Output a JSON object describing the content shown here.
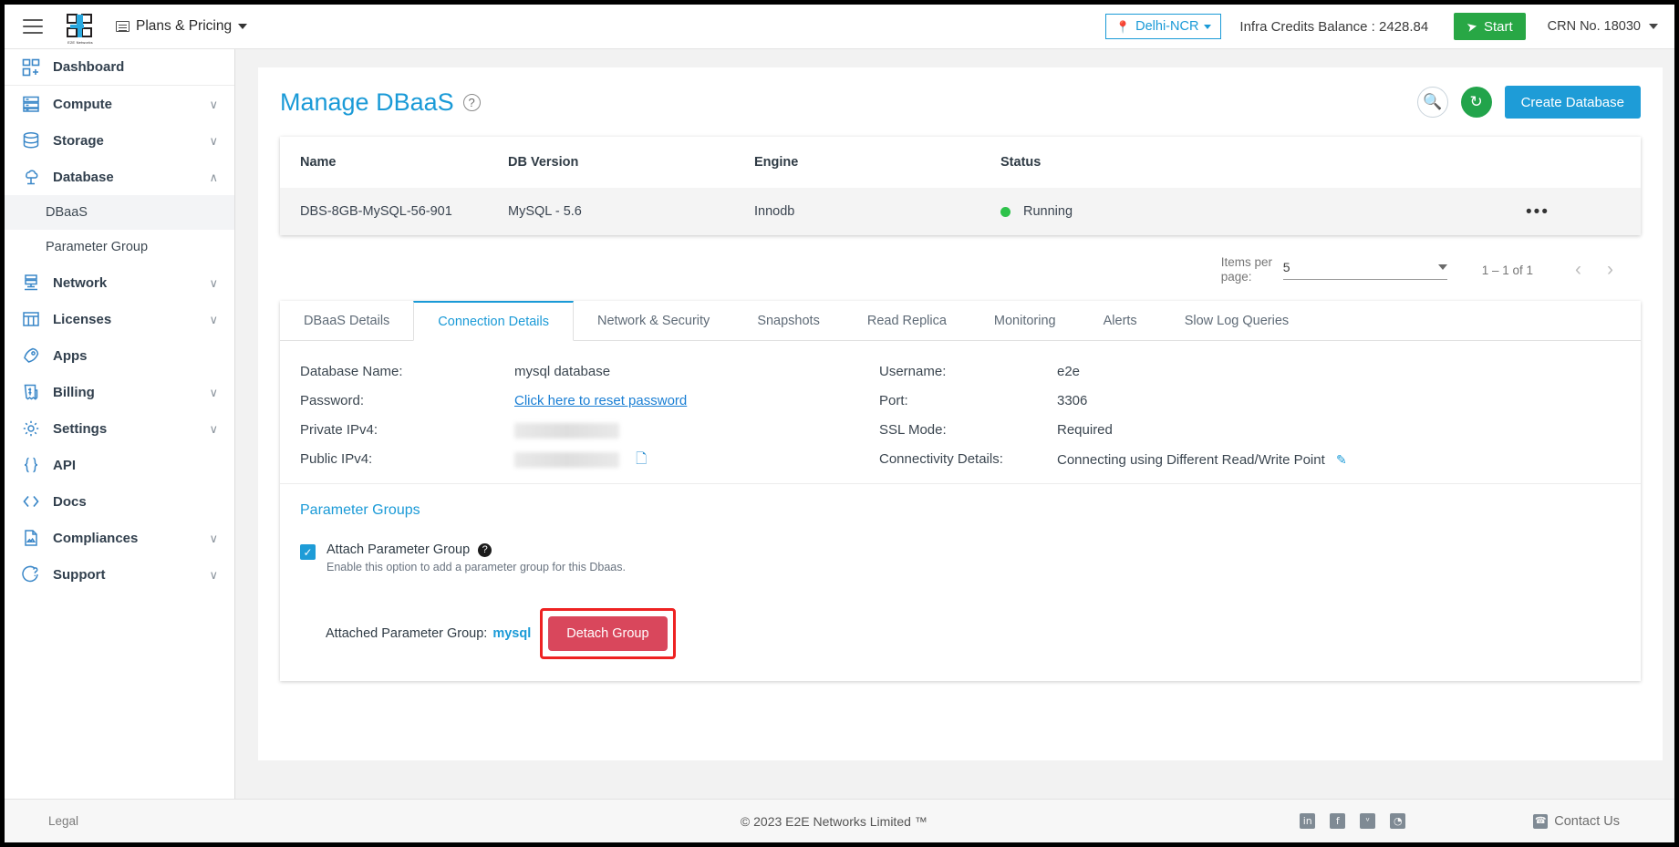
{
  "topbar": {
    "menu_icon": "hamburger-icon",
    "logo_text": "E2E Networks",
    "plans_label": "Plans & Pricing",
    "region": "Delhi-NCR",
    "credits": "Infra Credits Balance : 2428.84",
    "start_label": "Start",
    "crn": "CRN No. 18030"
  },
  "sidebar": {
    "items": [
      {
        "label": "Dashboard",
        "icon": "dashboard-icon",
        "chevron": ""
      },
      {
        "label": "Compute",
        "icon": "server-icon",
        "chevron": "∨"
      },
      {
        "label": "Storage",
        "icon": "storage-icon",
        "chevron": "∨"
      },
      {
        "label": "Database",
        "icon": "database-cloud-icon",
        "chevron": "∧"
      },
      {
        "label": "Network",
        "icon": "network-icon",
        "chevron": "∨"
      },
      {
        "label": "Licenses",
        "icon": "licenses-icon",
        "chevron": "∨"
      },
      {
        "label": "Apps",
        "icon": "rocket-icon",
        "chevron": ""
      },
      {
        "label": "Billing",
        "icon": "billing-icon",
        "chevron": "∨"
      },
      {
        "label": "Settings",
        "icon": "gear-icon",
        "chevron": "∨"
      },
      {
        "label": "API",
        "icon": "braces-icon",
        "chevron": ""
      },
      {
        "label": "Docs",
        "icon": "code-icon",
        "chevron": ""
      },
      {
        "label": "Compliances",
        "icon": "document-icon",
        "chevron": "∨"
      },
      {
        "label": "Support",
        "icon": "support-icon",
        "chevron": "∨"
      }
    ],
    "database_children": [
      {
        "label": "DBaaS",
        "active": true
      },
      {
        "label": "Parameter Group",
        "active": false
      }
    ]
  },
  "page": {
    "title": "Manage DBaaS",
    "help_icon": "help-circle-icon",
    "search_icon": "search-icon",
    "refresh_icon": "refresh-icon",
    "create_label": "Create Database"
  },
  "table": {
    "columns": [
      "Name",
      "DB Version",
      "Engine",
      "Status",
      ""
    ],
    "rows": [
      {
        "name": "DBS-8GB-MySQL-56-901",
        "db_version": "MySQL - 5.6",
        "engine": "Innodb",
        "status": "Running",
        "status_color": "#2ec24b",
        "actions_icon": "kebab-menu-icon"
      }
    ]
  },
  "paginator": {
    "items_per_page_label": "Items per page:",
    "items_per_page_value": "5",
    "range": "1 – 1 of 1",
    "prev_icon": "‹",
    "next_icon": "›"
  },
  "tabs": [
    {
      "label": "DBaaS Details",
      "active": false
    },
    {
      "label": "Connection Details",
      "active": true
    },
    {
      "label": "Network & Security",
      "active": false
    },
    {
      "label": "Snapshots",
      "active": false
    },
    {
      "label": "Read Replica",
      "active": false
    },
    {
      "label": "Monitoring",
      "active": false
    },
    {
      "label": "Alerts",
      "active": false
    },
    {
      "label": "Slow Log Queries",
      "active": false
    }
  ],
  "connection": {
    "left": [
      {
        "label": "Database Name:",
        "value": "mysql database",
        "kind": "text"
      },
      {
        "label": "Password:",
        "value": "Click here to reset password",
        "kind": "link"
      },
      {
        "label": "Private IPv4:",
        "value": "",
        "kind": "redacted"
      },
      {
        "label": "Public IPv4:",
        "value": "",
        "kind": "redacted-copy"
      }
    ],
    "right": [
      {
        "label": "Username:",
        "value": "e2e",
        "kind": "text"
      },
      {
        "label": "Port:",
        "value": "3306",
        "kind": "text"
      },
      {
        "label": "SSL Mode:",
        "value": "Required",
        "kind": "text"
      },
      {
        "label": "Connectivity Details:",
        "value": "Connecting using Different Read/Write Point",
        "kind": "edit"
      }
    ]
  },
  "parameter_groups": {
    "title": "Parameter Groups",
    "checkbox_checked": true,
    "checkbox_label": "Attach Parameter Group",
    "checkbox_help_icon": "help-icon",
    "checkbox_sub": "Enable this option to add a parameter group for this Dbaas.",
    "attached_prefix": "Attached Parameter Group:",
    "attached_name": "mysql",
    "detach_label": "Detach Group",
    "detach_highlight_color": "#ee2222",
    "detach_button_color": "#d9475c"
  },
  "footer": {
    "legal": "Legal",
    "copyright_symbol": "© 2023",
    "company": "E2E Networks Limited ™",
    "social": [
      {
        "name": "linkedin-icon",
        "glyph": "in"
      },
      {
        "name": "facebook-icon",
        "glyph": "f"
      },
      {
        "name": "twitter-icon",
        "glyph": "ᵛ"
      },
      {
        "name": "rss-icon",
        "glyph": "◔"
      }
    ],
    "contact": "Contact Us"
  },
  "colors": {
    "accent": "#1a9ad7",
    "green": "#28a745",
    "danger": "#d9475c",
    "highlight": "#ee2222"
  }
}
